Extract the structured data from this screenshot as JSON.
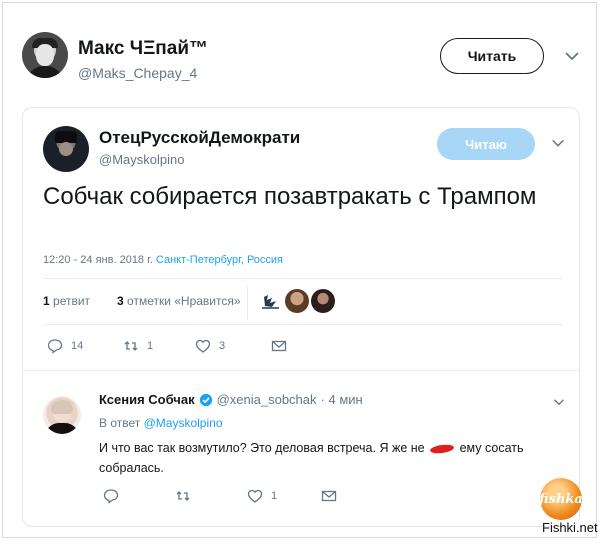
{
  "header": {
    "name": "Макс ЧΞпай™",
    "handle": "@Maks_Chepay_4",
    "follow_label": "Читать"
  },
  "embedded": {
    "name": "ОтецРусскойДемократи",
    "handle": "@Mayskolpino",
    "follow_label": "Читаю",
    "text": "Собчак собирается позавтракать с Трампом",
    "time": "12:20 - 24 янв. 2018 г.",
    "location": "Санкт-Петербург, Россия",
    "retweets_count": "1",
    "retweets_label": "ретвит",
    "likes_count": "3",
    "likes_label": "отметки «Нравится»",
    "actions": {
      "replies": "14",
      "retweets": "1",
      "likes": "3"
    }
  },
  "reply": {
    "name": "Ксения Собчак",
    "handle": "@xenia_sobchak",
    "time": "· 4 мин",
    "replying_prefix": "В ответ",
    "replying_to": "@Mayskolpino",
    "text_before": "И что вас так возмутило? Это деловая встреча. Я же не",
    "text_after": "ему сосать собралась.",
    "actions": {
      "likes": "1"
    }
  },
  "watermark": {
    "logo_text": "fishka",
    "site": "Fishki.net"
  },
  "colors": {
    "accent": "#1da1f2",
    "follow_disabled": "#a8d6f7",
    "censor": "#e0201d"
  }
}
